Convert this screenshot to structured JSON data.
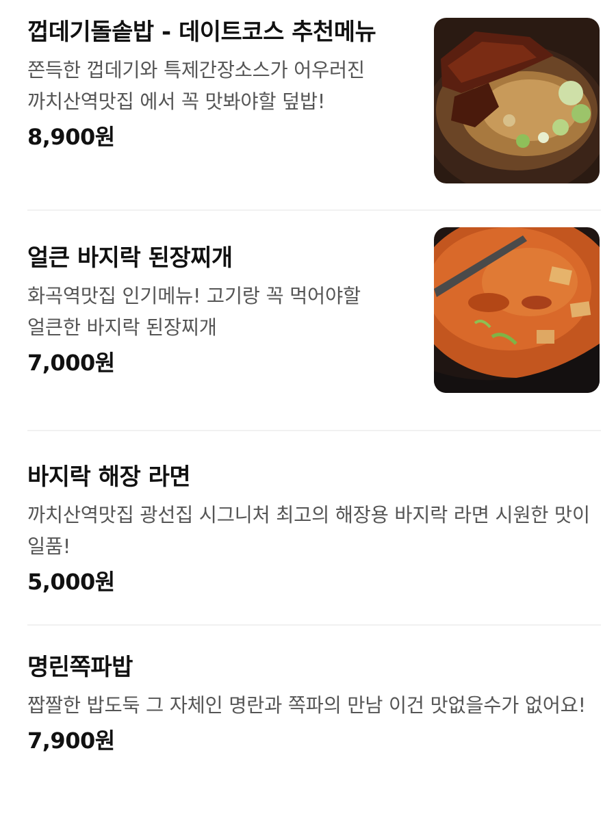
{
  "menu": {
    "items": [
      {
        "name": "껍데기돌솥밥 - 데이트코스 추천메뉴",
        "description": "쫀득한 껍데기와 특제간장소스가 어우러진 까치산역맛집 에서 꼭 맛봐야할 덮밥!",
        "price": "8,900원",
        "image_icon": "food-photo-icon"
      },
      {
        "name": "얼큰 바지락 된장찌개",
        "description": "화곡역맛집 인기메뉴! 고기랑 꼭 먹어야할 얼큰한 바지락 된장찌개",
        "price": "7,000원",
        "image_icon": "food-photo-icon"
      },
      {
        "name": "바지락 해장 라면",
        "description": "까치산역맛집 광선집 시그니처 최고의 해장용 바지락 라면 시원한 맛이 일품!",
        "price": "5,000원"
      },
      {
        "name": "명린쪽파밥",
        "description": "짭짤한 밥도둑 그 자체인 명란과 쪽파의 만남 이건 맛없을수가 없어요!",
        "price": "7,900원"
      }
    ]
  },
  "colors": {
    "text_primary": "#111111",
    "text_secondary": "#555555",
    "divider": "#f1f1f1",
    "background": "#ffffff"
  }
}
